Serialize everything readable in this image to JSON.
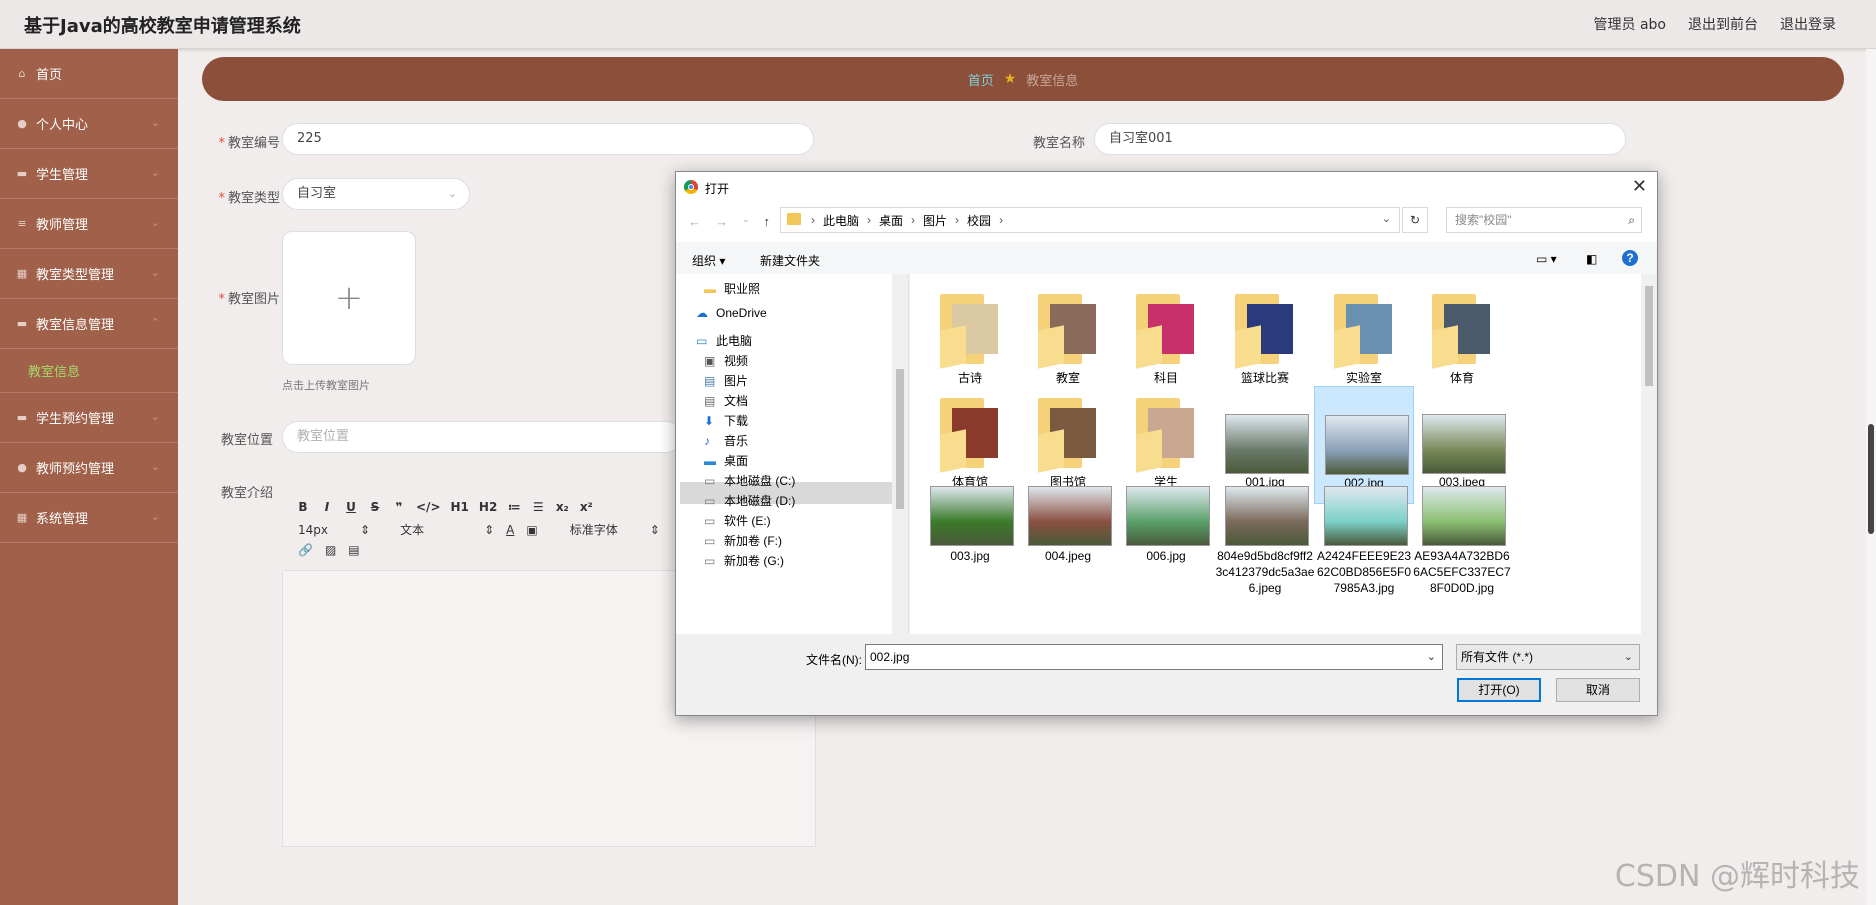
{
  "app": {
    "title": "基于Java的高校教室申请管理系统",
    "links": [
      "管理员 abo",
      "退出到前台",
      "退出登录"
    ]
  },
  "sidebar": {
    "items": [
      {
        "label": "首页",
        "icon": "home-icon"
      },
      {
        "label": "个人中心",
        "icon": "user-icon"
      },
      {
        "label": "学生管理",
        "icon": "monitor-icon"
      },
      {
        "label": "教师管理",
        "icon": "list-icon"
      },
      {
        "label": "教室类型管理",
        "icon": "table-icon"
      },
      {
        "label": "教室信息管理",
        "icon": "monitor-icon"
      },
      {
        "label": "学生预约管理",
        "icon": "monitor-icon"
      },
      {
        "label": "教师预约管理",
        "icon": "user-icon"
      },
      {
        "label": "系统管理",
        "icon": "grid-icon"
      }
    ],
    "sub_active": "教室信息"
  },
  "breadcrumb": {
    "home": "首页",
    "current": "教室信息"
  },
  "form": {
    "number_label": "教室编号",
    "number_value": "225",
    "name_label": "教室名称",
    "name_value": "自习室001",
    "type_label": "教室类型",
    "type_value": "自习室",
    "image_label": "教室图片",
    "upload_tip": "点击上传教室图片",
    "location_label": "教室位置",
    "location_placeholder": "教室位置",
    "intro_label": "教室介绍"
  },
  "editor": {
    "row1": [
      "B",
      "I",
      "U",
      "S",
      "❞",
      "</>",
      "H1",
      "H2",
      "≔",
      "☰",
      "x₂",
      "x²"
    ],
    "font_size": "14px",
    "text_style": "文本",
    "font_family": "标准字体"
  },
  "dialog": {
    "title": "打开",
    "path": [
      "此电脑",
      "桌面",
      "图片",
      "校园"
    ],
    "search_placeholder": "搜索\"校园\"",
    "organize": "组织 ▾",
    "new_folder": "新建文件夹",
    "tree": [
      {
        "label": "职业照",
        "indent": 1
      },
      {
        "label": "OneDrive",
        "indent": 0
      },
      {
        "label": "此电脑",
        "indent": 0
      },
      {
        "label": "视频",
        "indent": 1
      },
      {
        "label": "图片",
        "indent": 1
      },
      {
        "label": "文档",
        "indent": 1
      },
      {
        "label": "下载",
        "indent": 1
      },
      {
        "label": "音乐",
        "indent": 1
      },
      {
        "label": "桌面",
        "indent": 1
      },
      {
        "label": "本地磁盘 (C:)",
        "indent": 1
      },
      {
        "label": "本地磁盘 (D:)",
        "indent": 1
      },
      {
        "label": "软件 (E:)",
        "indent": 1
      },
      {
        "label": "新加卷 (F:)",
        "indent": 1
      },
      {
        "label": "新加卷 (G:)",
        "indent": 1
      }
    ],
    "files": [
      {
        "name": "古诗",
        "kind": "folder",
        "color": "#d9c8a0"
      },
      {
        "name": "教室",
        "kind": "folder",
        "color": "#8a6a5a"
      },
      {
        "name": "科目",
        "kind": "folder",
        "color": "#c8306a"
      },
      {
        "name": "篮球比赛",
        "kind": "folder",
        "color": "#2a3a7a"
      },
      {
        "name": "实验室",
        "kind": "folder",
        "color": "#6a90b0"
      },
      {
        "name": "体育",
        "kind": "folder",
        "color": "#4a5a6a"
      },
      {
        "name": "体育馆",
        "kind": "folder",
        "color": "#8a3a2a"
      },
      {
        "name": "图书馆",
        "kind": "folder",
        "color": "#7a5a40"
      },
      {
        "name": "学生",
        "kind": "folder",
        "color": "#c8a890"
      },
      {
        "name": "001.jpg",
        "kind": "image",
        "color": "#6a7a6a"
      },
      {
        "name": "002.jpg",
        "kind": "image",
        "color": "#8aa0b8",
        "selected": true
      },
      {
        "name": "003.jpeg",
        "kind": "image",
        "color": "#7a8a5a"
      },
      {
        "name": "003.jpg",
        "kind": "image",
        "color": "#3a7a2a"
      },
      {
        "name": "004.jpeg",
        "kind": "image",
        "color": "#8a5040"
      },
      {
        "name": "006.jpg",
        "kind": "image",
        "color": "#5aa06a"
      },
      {
        "name": "804e9d5bd8cf9ff23c412379dc5a3ae6.jpeg",
        "kind": "image",
        "color": "#7a6a5a"
      },
      {
        "name": "A2424FEEE9E2362C0BD856E5F07985A3.jpg",
        "kind": "image",
        "color": "#7ad0c8"
      },
      {
        "name": "AE93A4A732BD66AC5EFC337EC78F0D0D.jpg",
        "kind": "image",
        "color": "#8ac070"
      }
    ],
    "filename_label": "文件名(N):",
    "filename_value": "002.jpg",
    "filetype_value": "所有文件 (*.*)",
    "open_label": "打开(O)",
    "cancel_label": "取消"
  },
  "watermark": "CSDN @辉时科技"
}
